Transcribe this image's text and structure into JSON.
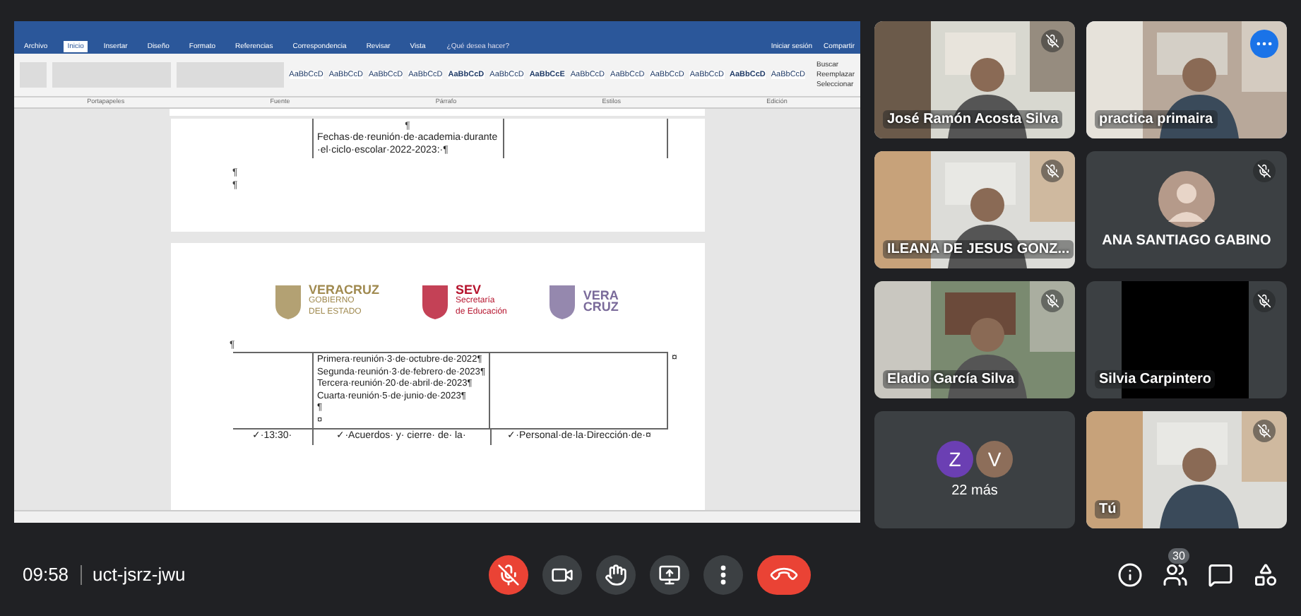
{
  "shared_screen": {
    "word": {
      "tabs": [
        {
          "label": "Archivo",
          "selected": false
        },
        {
          "label": "Inicio",
          "selected": true
        },
        {
          "label": "Insertar",
          "selected": false
        },
        {
          "label": "Diseño",
          "selected": false
        },
        {
          "label": "Formato",
          "selected": false
        },
        {
          "label": "Referencias",
          "selected": false
        },
        {
          "label": "Correspondencia",
          "selected": false
        },
        {
          "label": "Revisar",
          "selected": false
        },
        {
          "label": "Vista",
          "selected": false
        }
      ],
      "tell_me": "¿Qué desea hacer?",
      "sign_in": "Iniciar sesión",
      "share": "Compartir",
      "styles": [
        {
          "sample": "AaBbCcD",
          "bold": false
        },
        {
          "sample": "AaBbCcD",
          "bold": false
        },
        {
          "sample": "AaBbCcD",
          "bold": false
        },
        {
          "sample": "AaBbCcD",
          "bold": false
        },
        {
          "sample": "AaBbCcD",
          "bold": true
        },
        {
          "sample": "AaBbCcD",
          "bold": false
        },
        {
          "sample": "AaBbCcE",
          "bold": true
        },
        {
          "sample": "AaBbCcD",
          "bold": false
        },
        {
          "sample": "AaBbCcD",
          "bold": false
        },
        {
          "sample": "AaBbCcD",
          "bold": false
        },
        {
          "sample": "AaBbCcD",
          "bold": false
        },
        {
          "sample": "AaBbCcD",
          "bold": true
        },
        {
          "sample": "AaBbCcD",
          "bold": false
        }
      ],
      "editing": [
        "Buscar",
        "Reemplazar",
        "Seleccionar"
      ],
      "groups": [
        "Portapapeles",
        "Fuente",
        "Párrafo",
        "Estilos",
        "Edición"
      ]
    },
    "page_1": {
      "cell_mark": "¶",
      "cell_text": "Fechas·de·reunión·de·academia·durante·el·ciclo·escolar·2022-2023:·¶",
      "marks": [
        "¶",
        "¶"
      ]
    },
    "page_2": {
      "logos": [
        {
          "kind": "gobierno",
          "lines": [
            "VERACRUZ",
            "GOBIERNO",
            "DEL ESTADO"
          ]
        },
        {
          "kind": "sev",
          "lines": [
            "SEV",
            "Secretaría",
            "de Educación"
          ]
        },
        {
          "kind": "veracruz",
          "lines": [
            "VERA",
            "CRUZ"
          ]
        }
      ],
      "mark": "¶",
      "cell_lines": [
        "Primera·reunión·3·de·octubre·de·2022¶",
        "Segunda·reunión·3·de·febrero·de·2023¶",
        "Tercera·reunión·20·de·abril·de·2023¶",
        "Cuarta·reunión·5·de·junio·de·2023¶",
        "¶",
        "¤"
      ],
      "row_end": "¤",
      "next_row": [
        "✓·13:30·",
        "✓·Acuerdos· y· cierre· de· la·",
        "✓·Personal·de·la·Dirección·de·¤"
      ]
    }
  },
  "participants": [
    {
      "kind": "video",
      "name": "José Ramón Acosta Silva",
      "muted": true,
      "highlighted": false
    },
    {
      "kind": "video",
      "name": "practica primaira",
      "muted": false,
      "highlighted": true
    },
    {
      "kind": "video",
      "name": "ILEANA DE JESUS GONZ...",
      "muted": true,
      "highlighted": false
    },
    {
      "kind": "avatar",
      "name": "ANA SANTIAGO GABINO",
      "muted": true,
      "highlighted": false
    },
    {
      "kind": "video",
      "name": "Eladio García Silva",
      "muted": true,
      "highlighted": false
    },
    {
      "kind": "blank",
      "name": "Silvia Carpintero",
      "muted": true,
      "highlighted": false
    },
    {
      "kind": "overflow",
      "name": "22 más",
      "avatars": [
        {
          "letter": "Z",
          "color": "#6b3fb3"
        },
        {
          "letter": "V",
          "color": "#8d6e5a"
        }
      ]
    },
    {
      "kind": "video",
      "name": "Tú",
      "muted": true,
      "highlighted": false
    }
  ],
  "bottom_bar": {
    "time": "09:58",
    "meeting_code": "uct-jsrz-jwu",
    "mic_muted": true,
    "people_count": "30"
  }
}
